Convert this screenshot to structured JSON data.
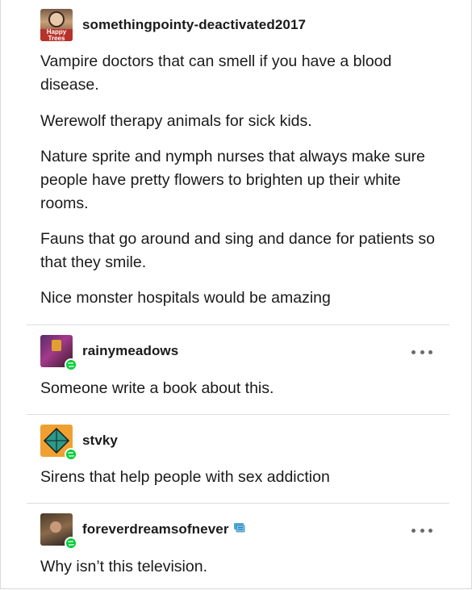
{
  "thread": [
    {
      "username": "somethingpointy-deactivated2017",
      "avatar_text": "Happy Trees",
      "paragraphs": [
        "Vampire doctors that can smell if you have a blood disease.",
        "Werewolf therapy animals for sick kids.",
        "Nature sprite and nymph nurses that always make sure people have pretty flowers to brighten up their white rooms.",
        "Fauns that go around and sing and dance for patients so that they smile.",
        "Nice monster hospitals would be amazing"
      ]
    },
    {
      "username": "rainymeadows",
      "paragraphs": [
        "Someone write a book about this."
      ]
    },
    {
      "username": "stvky",
      "paragraphs": [
        "Sirens that help people with sex addiction"
      ]
    },
    {
      "username": "foreverdreamsofnever",
      "paragraphs": [
        "Why isn’t this television."
      ]
    }
  ],
  "colors": {
    "text": "#1a1a1a",
    "divider": "#dedede",
    "reblog_green": "#00cf35",
    "more_dots": "#6b6b6b"
  },
  "icons": [
    "more-options-icon",
    "reblog-icon",
    "badge-icon"
  ]
}
